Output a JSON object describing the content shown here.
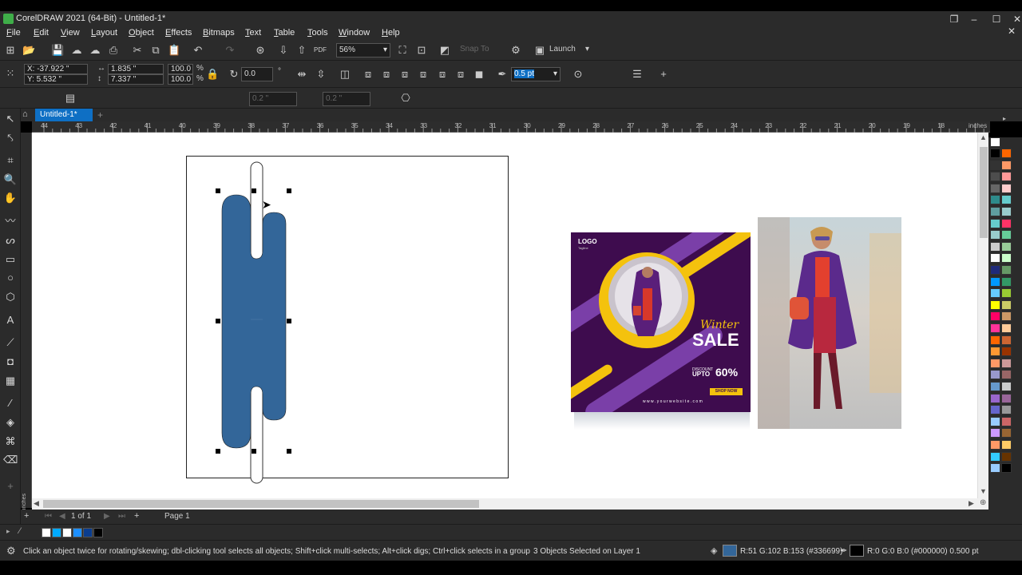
{
  "window": {
    "title": "CorelDRAW 2021 (64-Bit) - Untitled-1*",
    "controls": [
      "restore-down",
      "minimize",
      "maximize",
      "close"
    ]
  },
  "menu": [
    "File",
    "Edit",
    "View",
    "Layout",
    "Object",
    "Effects",
    "Bitmaps",
    "Text",
    "Table",
    "Tools",
    "Window",
    "Help"
  ],
  "toolbar": {
    "zoom": "56%",
    "snap_to": "Snap To",
    "launch": "Launch"
  },
  "property_bar": {
    "x": "X: -37.922 \"",
    "y": "Y: 5.532 \"",
    "width": "1.835 \"",
    "height": "7.337 \"",
    "scale_w": "100.0",
    "scale_h": "100.0",
    "percent": "%",
    "rotation": "0.0",
    "outline_width": "0.5 pt",
    "corner_a": "0.2 \"",
    "corner_b": "0.2 \""
  },
  "doc_tab": "Untitled-1*",
  "ruler": {
    "h_ticks": [
      "44",
      "43",
      "42",
      "41",
      "40",
      "39",
      "38",
      "37",
      "36",
      "35",
      "34",
      "33",
      "32",
      "31",
      "30",
      "29",
      "28",
      "27",
      "26",
      "25",
      "24",
      "23",
      "22",
      "21",
      "20",
      "19",
      "18"
    ],
    "unit": "inches",
    "v_unit": "inches"
  },
  "canvas": {
    "shape_fill": "#336699",
    "ad": {
      "logo": "LOGO",
      "tagline": "Tagline",
      "winter": "Winter",
      "sale": "SALE",
      "discount_label": "DISCOUNT",
      "upto": "UPTO",
      "percent": "60%",
      "shop_now": "SHOP NOW",
      "website": "w w w . y o u r w e b s i t e . c o m",
      "colors": {
        "bg": "#3e0c4e",
        "accent": "#f4c20d",
        "stripe": "#7a3fa8"
      }
    }
  },
  "pages": {
    "counter": "1 of 1",
    "tab": "Page 1"
  },
  "status": {
    "hint": "Click an object twice for rotating/skewing; dbl-clicking tool selects all objects; Shift+click multi-selects; Alt+click digs; Ctrl+click selects in a group",
    "selection": "3 Objects Selected on Layer 1",
    "fill_info": "R:51 G:102 B:153 (#336699)",
    "outline_info": "R:0 G:0 B:0 (#000000)  0.500 pt"
  },
  "palette_colors": [
    "#000000",
    "#ff6600",
    "#333333",
    "#ff9966",
    "#4d4d4d",
    "#ff9999",
    "#666666",
    "#ffcccc",
    "#2e8b8b",
    "#66cccc",
    "#5f9ea0",
    "#99cccc",
    "#66cccc",
    "#ff3366",
    "#99cccc",
    "#66cc99",
    "#cccccc",
    "#99cc99",
    "#ffffff",
    "#ccffcc",
    "#1f2a7a",
    "#669966",
    "#0099ff",
    "#339966",
    "#66ccff",
    "#99cc33",
    "#ffff00",
    "#cccc66",
    "#ff0066",
    "#cc9966",
    "#ff3399",
    "#ffcc99",
    "#ff6600",
    "#cc6633",
    "#ff9933",
    "#993300",
    "#ff9966",
    "#cc9999",
    "#9999cc",
    "#996666",
    "#6699cc",
    "#cccccc",
    "#9966cc",
    "#996699",
    "#6666cc",
    "#999999",
    "#99ccff",
    "#cc6666",
    "#cc99ff",
    "#996633",
    "#ff9966",
    "#ffcc66",
    "#33ccff",
    "#663300",
    "#99ccff",
    "#000000"
  ],
  "quick_colors": [
    "#ffffff",
    "#00aaff",
    "#ffffff",
    "#1e90ff",
    "#0a3d8f",
    "#000000"
  ]
}
